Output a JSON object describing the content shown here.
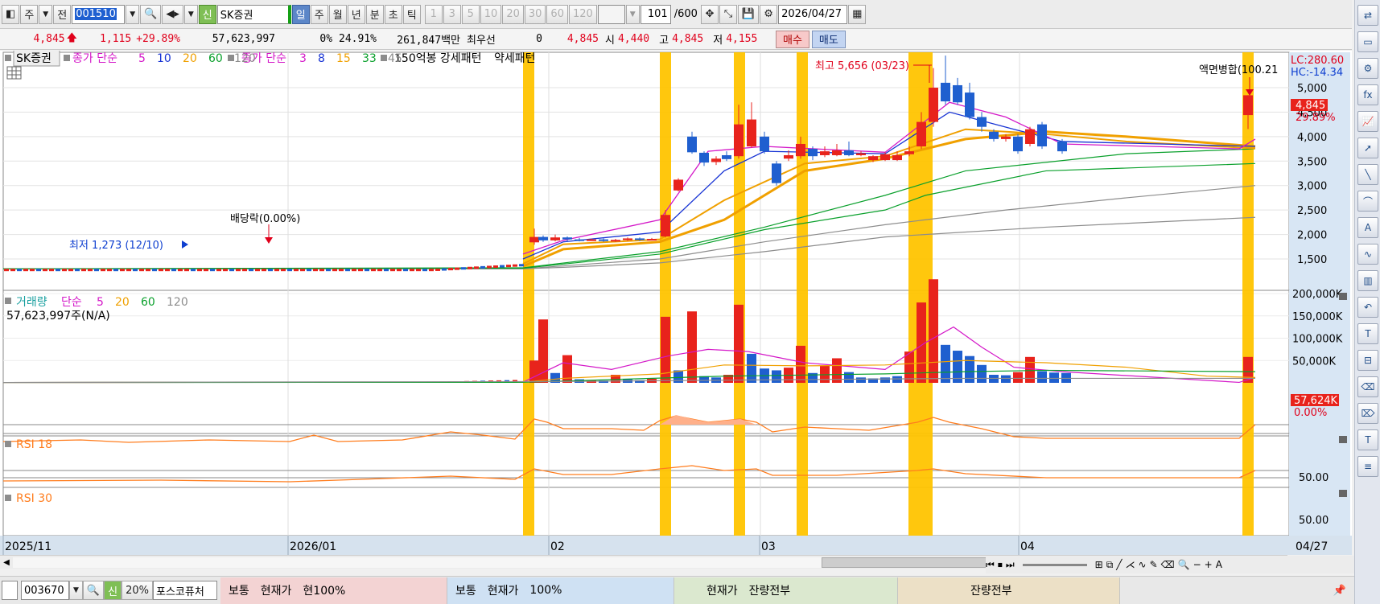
{
  "toolbar": {
    "period_kind": "주",
    "prev_label": "전",
    "stock_code": "001510",
    "credit_badge": "신",
    "stock_name": "SK증권",
    "period_tabs": [
      "일",
      "주",
      "월",
      "년",
      "분",
      "초",
      "틱"
    ],
    "interval_tabs": [
      "1",
      "3",
      "5",
      "10",
      "20",
      "30",
      "60",
      "120"
    ],
    "count_value": "101",
    "count_total": "/600",
    "date_value": "2026/04/27"
  },
  "quote": {
    "price": "4,845",
    "change": "1,115",
    "change_pct": "+29.89%",
    "volume": "57,623,997",
    "ratio1": "0%",
    "ratio2": "24.91%",
    "amount": "261,847백만",
    "preferred_label": "최우선",
    "preferred_value": "0",
    "last_price": "4,845",
    "open_label": "시",
    "open": "4,440",
    "high_label": "고",
    "high": "4,845",
    "low_label": "저",
    "low": "4,155",
    "buy_label": "매수",
    "sell_label": "매도"
  },
  "legend": {
    "stock_name": "SK증권",
    "ma_label_a": "종가 단순",
    "ma_a_periods": [
      {
        "value": "5",
        "color": "#d417c8"
      },
      {
        "value": "10",
        "color": "#1733d4"
      },
      {
        "value": "20",
        "color": "#f0a000"
      },
      {
        "value": "60",
        "color": "#0aa02c"
      },
      {
        "value": "120",
        "color": "#8c8c8c"
      }
    ],
    "ma_label_b": "종가 단순",
    "ma_b_periods": [
      {
        "value": "3",
        "color": "#d417c8"
      },
      {
        "value": "8",
        "color": "#1733d4"
      },
      {
        "value": "15",
        "color": "#f0a000"
      },
      {
        "value": "33",
        "color": "#0aa02c"
      },
      {
        "value": "45",
        "color": "#8c8c8c"
      }
    ],
    "pattern_label": "150억봉 강세패턴",
    "weak_label": "약세패턴"
  },
  "price_panel": {
    "lc_label": "LC:280.60",
    "hc_label": "HC:-14.34",
    "y_ticks": [
      "5,000",
      "4,500",
      "4,000",
      "3,500",
      "3,000",
      "2,500",
      "2,000",
      "1,500"
    ],
    "current_price_tag": "4,845",
    "current_pct_tag": "29.89%",
    "annotation_high": "최고 5,656 (03/23)",
    "annotation_low": "최저 1,273 (12/10)",
    "annotation_dividend": "배당락(0.00%)",
    "annotation_split": "액면병합(100.21"
  },
  "volume_panel": {
    "label": "거래량",
    "ma_label": "단순",
    "periods": [
      {
        "value": "5",
        "color": "#d417c8"
      },
      {
        "value": "20",
        "color": "#f0a000"
      },
      {
        "value": "60",
        "color": "#0aa02c"
      },
      {
        "value": "120",
        "color": "#8c8c8c"
      }
    ],
    "volume_text": "57,623,997주(N/A)",
    "y_ticks": [
      "200,000K",
      "150,000K",
      "100,000K",
      "50,000K"
    ],
    "current_tag": "57,624K",
    "current_pct": "0.00%"
  },
  "rsi18": {
    "label": "RSI 18",
    "tick": "50.00"
  },
  "rsi30": {
    "label": "RSI 30",
    "tick": "50.00"
  },
  "x_axis": {
    "labels": [
      "2025/11",
      "2026/01",
      "02",
      "03",
      "04"
    ],
    "end_label": "04/27"
  },
  "bottom": {
    "code": "003670",
    "credit_badge": "신",
    "ratio": "20%",
    "name": "포스코퓨처",
    "panel1": [
      "보통",
      "현재가",
      "현100%"
    ],
    "panel2": [
      "보통",
      "현재가",
      "100%"
    ],
    "panel3": [
      "현재가",
      "잔량전부"
    ],
    "panel4": [
      "잔량전부"
    ]
  },
  "colors": {
    "up": "#e8231c",
    "down": "#1f5fcf",
    "highlight": "#ffc400",
    "ma5": "#d417c8",
    "ma10": "#1733d4",
    "ma20": "#f0a000",
    "ma60": "#0aa02c",
    "ma120": "#8c8c8c",
    "rsi": "#ff7d1e"
  },
  "side_icons": [
    "link-icon",
    "window-icon",
    "gear-icon",
    "formula-icon",
    "chart-add-icon",
    "cursor-icon",
    "line-tool-icon",
    "trend-icon",
    "auto-line-icon",
    "wave-icon",
    "candle-icon",
    "arrow-icon",
    "text-icon",
    "order-icon",
    "eraser-icon",
    "erase-all-icon",
    "text-t-icon",
    "grid-icon"
  ]
}
